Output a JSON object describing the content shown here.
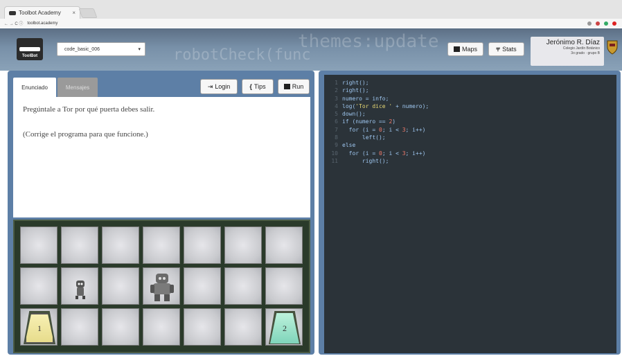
{
  "browser": {
    "tab_title": "Toolbot Academy",
    "tab_close": "×",
    "nav": "← → C ⓘ",
    "url": "toolbot.academy"
  },
  "header": {
    "logo_text": "ToolBot",
    "map_select_value": "code_basic_006",
    "maps_label": "Maps",
    "stats_label": "Stats",
    "user_name": "Jerónimo R. Díaz",
    "user_school": "Colegio Jardín Botánico",
    "user_group": "3o grado · grupo B",
    "bg_text_1": "themes:update",
    "bg_text_2": "robotCheck(func",
    "colors": {
      "accent": "#5d7fa6",
      "header": "#6e86a0"
    }
  },
  "left": {
    "tabs": [
      "Enunciado",
      "Mensajes"
    ],
    "login_label": "Login",
    "tips_label": "Tips",
    "run_label": "Run",
    "statement_lines": [
      "Pregúntale a Tor por qué puerta debes salir.",
      "(Corrige el programa para que funcione.)"
    ],
    "board": {
      "rows": 3,
      "cols": 7,
      "door_labels": [
        "1",
        "2"
      ]
    }
  },
  "editor": {
    "lines": [
      {
        "n": "1",
        "code": "right();"
      },
      {
        "n": "2",
        "code": "right();"
      },
      {
        "n": "3",
        "code": "numero = info;"
      },
      {
        "n": "4",
        "code": "log('Tor dice ' + numero);"
      },
      {
        "n": "5",
        "code": "down();"
      },
      {
        "n": "6",
        "code": "if (numero == 2)"
      },
      {
        "n": "7",
        "code": "  for (i = 0; i < 3; i++)"
      },
      {
        "n": "8",
        "code": "      left();"
      },
      {
        "n": "9",
        "code": "else"
      },
      {
        "n": "10",
        "code": "  for (i = 0; i < 3; i++)"
      },
      {
        "n": "11",
        "code": "      right();"
      }
    ]
  }
}
